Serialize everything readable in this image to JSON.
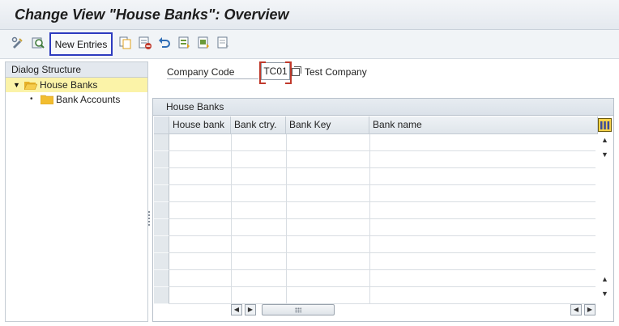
{
  "title": "Change View \"House Banks\": Overview",
  "toolbar": {
    "new_entries_label": "New Entries",
    "icons": [
      "display-change-icon",
      "details-icon",
      "copy-icon",
      "delete-icon",
      "undo-icon",
      "select-all-icon",
      "select-block-icon",
      "deselect-all-icon"
    ]
  },
  "dialog_structure": {
    "header": "Dialog Structure",
    "items": [
      {
        "label": "House Banks",
        "selected": true,
        "expanded": true
      },
      {
        "label": "Bank Accounts",
        "selected": false
      }
    ]
  },
  "company_code": {
    "label": "Company Code",
    "value": "TC01",
    "name": "Test Company"
  },
  "table": {
    "caption": "House Banks",
    "columns": [
      "House bank",
      "Bank ctry.",
      "Bank Key",
      "Bank name"
    ],
    "rows": []
  },
  "colors": {
    "title_bg": "#e9edf2",
    "highlight_border": "#2d3bbf",
    "selected_node_bg": "#fbf3a8",
    "required_bracket": "#c0392b"
  }
}
